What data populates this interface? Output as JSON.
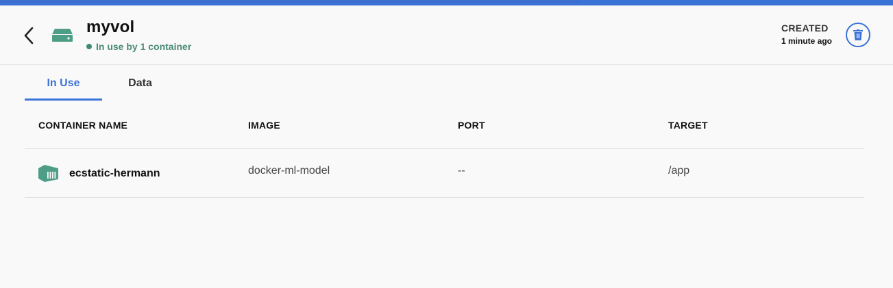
{
  "header": {
    "title": "myvol",
    "status": "In use by 1 container",
    "created_label": "CREATED",
    "created_value": "1 minute ago"
  },
  "tabs": [
    {
      "label": "In Use",
      "active": true
    },
    {
      "label": "Data",
      "active": false
    }
  ],
  "table": {
    "columns": [
      "CONTAINER NAME",
      "IMAGE",
      "PORT",
      "TARGET"
    ],
    "rows": [
      {
        "name": "ecstatic-hermann",
        "image": "docker-ml-model",
        "port": "--",
        "target": "/app"
      }
    ]
  },
  "colors": {
    "accent": "#3b72d6",
    "status_green": "#3f8a6f",
    "icon_teal": "#4e9e87"
  },
  "icons": {
    "back": "chevron-left-icon",
    "volume": "volume-drive-icon",
    "status": "status-dot-icon",
    "delete": "trash-icon",
    "container": "container-icon"
  }
}
